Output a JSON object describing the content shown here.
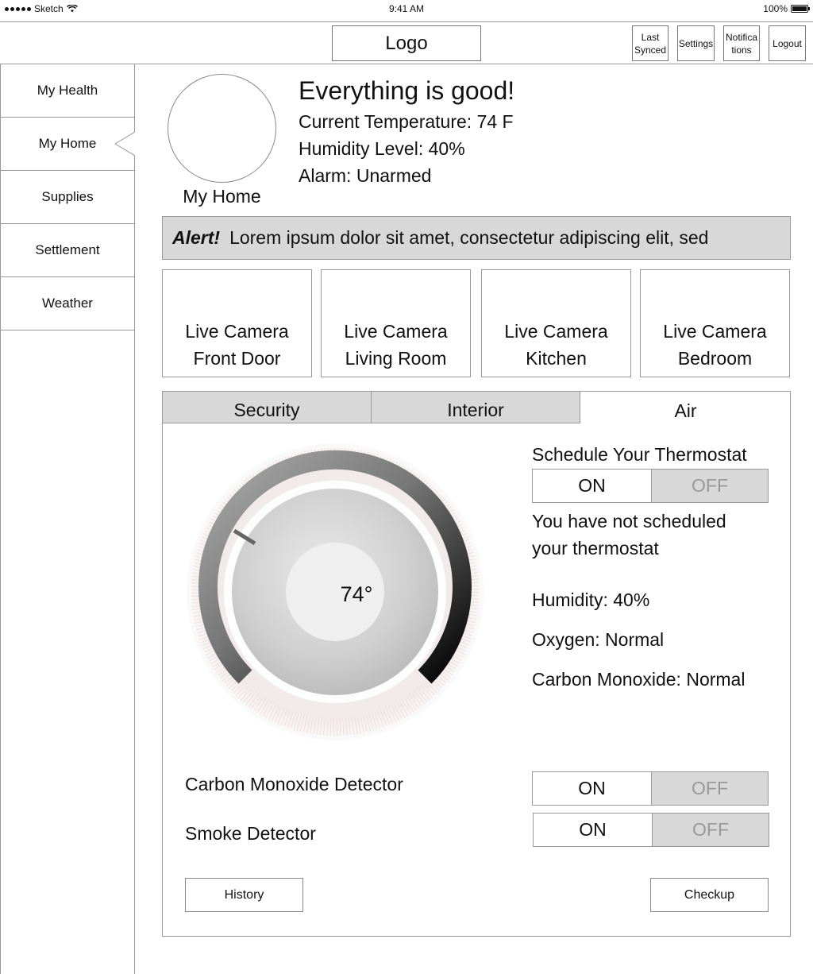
{
  "status_bar": {
    "carrier": "Sketch",
    "time": "9:41 AM",
    "battery": "100%"
  },
  "header": {
    "logo": "Logo",
    "last_synced": "Last Synced",
    "settings": "Settings",
    "notifications": "Notifications",
    "logout": "Logout"
  },
  "sidebar": {
    "items": [
      {
        "label": "My Health"
      },
      {
        "label": "My Home",
        "active": true
      },
      {
        "label": "Supplies"
      },
      {
        "label": "Settlement"
      },
      {
        "label": "Weather"
      }
    ]
  },
  "home": {
    "avatar_label": "My Home",
    "headline": "Everything is good!",
    "temperature": "Current Temperature: 74 F",
    "humidity": "Humidity Level: 40%",
    "alarm": "Alarm: Unarmed"
  },
  "alert": {
    "prefix": "Alert!",
    "message": "Lorem ipsum dolor sit amet, consectetur adipiscing elit, sed"
  },
  "cameras": [
    {
      "line1": "Live Camera",
      "line2": "Front Door"
    },
    {
      "line1": "Live Camera",
      "line2": "Living Room"
    },
    {
      "line1": "Live Camera",
      "line2": "Kitchen"
    },
    {
      "line1": "Live Camera",
      "line2": "Bedroom"
    }
  ],
  "tabs": [
    {
      "label": "Security",
      "active": false
    },
    {
      "label": "Interior",
      "active": false
    },
    {
      "label": "Air",
      "active": true
    }
  ],
  "air": {
    "thermostat_value": "74°",
    "schedule_title": "Schedule Your Thermostat",
    "schedule_toggle": {
      "on": "ON",
      "off": "OFF",
      "value": "ON"
    },
    "schedule_note_1": "You have not scheduled",
    "schedule_note_2": "your thermostat",
    "humidity": "Humidity: 40%",
    "oxygen": "Oxygen: Normal",
    "carbon_monoxide": "Carbon Monoxide: Normal",
    "co_detector_label": "Carbon Monoxide Detector",
    "co_detector_toggle": {
      "on": "ON",
      "off": "OFF",
      "value": "ON"
    },
    "smoke_detector_label": "Smoke Detector",
    "smoke_detector_toggle": {
      "on": "ON",
      "off": "OFF",
      "value": "ON"
    },
    "history_button": "History",
    "checkup_button": "Checkup"
  }
}
